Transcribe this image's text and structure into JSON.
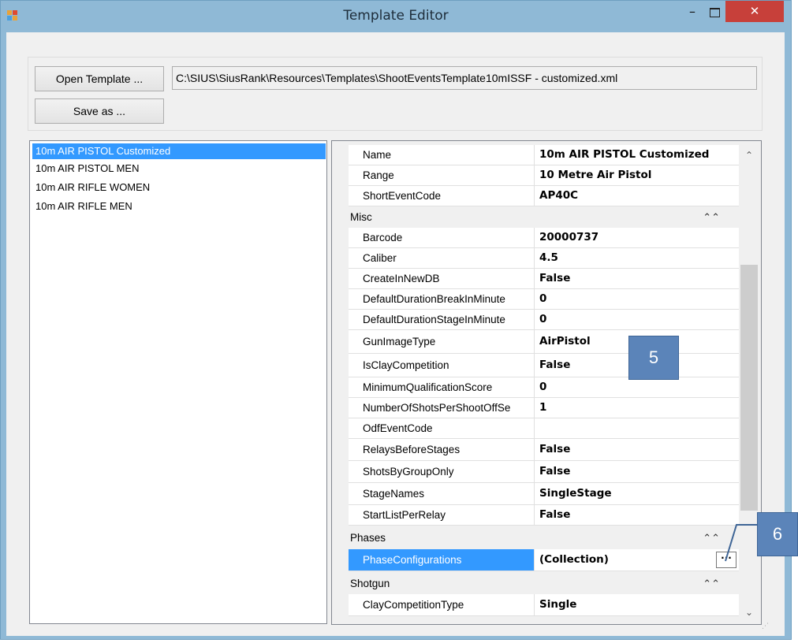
{
  "window": {
    "title": "Template Editor",
    "minimize_glyph": "–",
    "close_glyph": "✕",
    "icon": "app-grid-icon"
  },
  "toolbar": {
    "open_label": "Open Template ...",
    "save_label": "Save as ...",
    "path": "C:\\SIUS\\SiusRank\\Resources\\Templates\\ShootEventsTemplate10mISSF - customized.xml"
  },
  "list": {
    "items": [
      {
        "label": "10m AIR PISTOL Customized",
        "selected": true
      },
      {
        "label": "10m AIR PISTOL MEN",
        "selected": false
      },
      {
        "label": "10m AIR RIFLE WOMEN",
        "selected": false
      },
      {
        "label": "10m AIR RIFLE MEN",
        "selected": false
      }
    ]
  },
  "grid": {
    "top_rows": [
      {
        "name": "Name",
        "value": "10m AIR PISTOL Customized"
      },
      {
        "name": "Range",
        "value": "10 Metre Air Pistol"
      },
      {
        "name": "ShortEventCode",
        "value": "AP40C"
      }
    ],
    "misc": {
      "label": "Misc",
      "rows": [
        {
          "name": "Barcode",
          "value": "20000737"
        },
        {
          "name": "Caliber",
          "value": "4.5"
        },
        {
          "name": "CreateInNewDB",
          "value": "False"
        },
        {
          "name": "DefaultDurationBreakInMinute",
          "value": "0"
        },
        {
          "name": "DefaultDurationStageInMinute",
          "value": "0"
        },
        {
          "name": "GunImageType",
          "value": "AirPistol"
        },
        {
          "name": "IsClayCompetition",
          "value": "False"
        },
        {
          "name": "MinimumQualificationScore",
          "value": "0"
        },
        {
          "name": "NumberOfShotsPerShootOffSe",
          "value": "1"
        },
        {
          "name": "OdfEventCode",
          "value": ""
        },
        {
          "name": "RelaysBeforeStages",
          "value": "False"
        },
        {
          "name": "ShotsByGroupOnly",
          "value": "False"
        },
        {
          "name": "StageNames",
          "value": "SingleStage"
        },
        {
          "name": "StartListPerRelay",
          "value": "False"
        }
      ]
    },
    "phases": {
      "label": "Phases",
      "rows": [
        {
          "name": "PhaseConfigurations",
          "value": "(Collection)",
          "ellipsis": "···"
        }
      ]
    },
    "shotgun": {
      "label": "Shotgun",
      "rows": [
        {
          "name": "ClayCompetitionType",
          "value": "Single"
        }
      ]
    },
    "collapse_glyph": "⌃⌃"
  },
  "callouts": {
    "five": "5",
    "six": "6"
  },
  "colors": {
    "titlebar": "#8fb9d6",
    "close": "#c7403a",
    "selection": "#3399ff",
    "callout": "#5b84b9"
  }
}
